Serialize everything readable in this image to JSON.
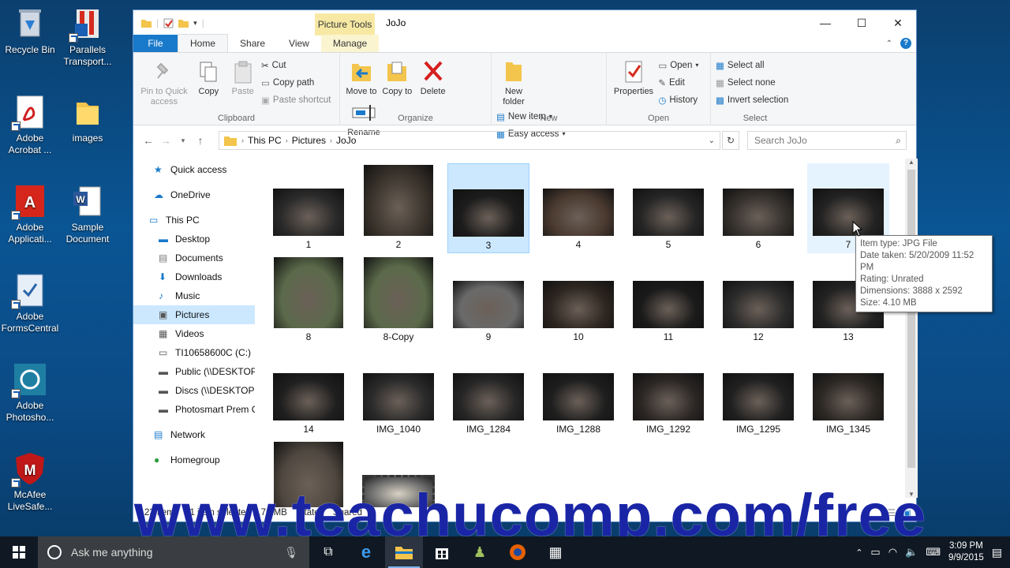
{
  "desktop": {
    "icons": [
      {
        "label": "Recycle Bin",
        "icon": "recycle-bin-icon"
      },
      {
        "label": "Parallels Transport...",
        "icon": "parallels-icon"
      },
      {
        "label": "Adobe Acrobat ...",
        "icon": "acrobat-icon"
      },
      {
        "label": "images",
        "icon": "folder-icon"
      },
      {
        "label": "Adobe Applicati...",
        "icon": "adobe-app-icon"
      },
      {
        "label": "Sample Document",
        "icon": "word-document-icon"
      },
      {
        "label": "Adobe FormsCentral",
        "icon": "formscentral-icon"
      },
      {
        "label": "Adobe Photosho...",
        "icon": "photoshop-icon"
      },
      {
        "label": "McAfee LiveSafe...",
        "icon": "mcafee-icon"
      }
    ]
  },
  "window": {
    "title": "JoJo",
    "context_tab": "Picture Tools",
    "tabs": [
      "File",
      "Home",
      "Share",
      "View",
      "Manage"
    ],
    "controls": {
      "minimize": "—",
      "maximize": "☐",
      "close": "✕"
    }
  },
  "ribbon": {
    "clipboard": {
      "label": "Clipboard",
      "pin": "Pin to Quick access",
      "copy": "Copy",
      "paste": "Paste",
      "cut": "Cut",
      "copy_path": "Copy path",
      "paste_shortcut": "Paste shortcut"
    },
    "organize": {
      "label": "Organize",
      "move_to": "Move to",
      "copy_to": "Copy to",
      "delete": "Delete",
      "rename": "Rename"
    },
    "new": {
      "label": "New",
      "new_folder": "New folder",
      "new_item": "New item",
      "easy_access": "Easy access"
    },
    "open": {
      "label": "Open",
      "properties": "Properties",
      "open": "Open",
      "edit": "Edit",
      "history": "History"
    },
    "select": {
      "label": "Select",
      "select_all": "Select all",
      "select_none": "Select none",
      "invert": "Invert selection"
    }
  },
  "address": {
    "crumbs": [
      "This PC",
      "Pictures",
      "JoJo"
    ],
    "search_placeholder": "Search JoJo"
  },
  "nav": [
    {
      "label": "Quick access",
      "icon": "star-icon"
    },
    {
      "label": "OneDrive",
      "icon": "cloud-icon"
    },
    {
      "label": "This PC",
      "icon": "computer-icon"
    },
    {
      "label": "Desktop",
      "icon": "desktop-icon"
    },
    {
      "label": "Documents",
      "icon": "documents-icon"
    },
    {
      "label": "Downloads",
      "icon": "download-icon"
    },
    {
      "label": "Music",
      "icon": "music-icon"
    },
    {
      "label": "Pictures",
      "icon": "pictures-icon"
    },
    {
      "label": "Videos",
      "icon": "videos-icon"
    },
    {
      "label": "TI10658600C (C:)",
      "icon": "drive-icon"
    },
    {
      "label": "Public (\\\\DESKTOP",
      "icon": "network-drive-icon"
    },
    {
      "label": "Discs (\\\\DESKTOP-I",
      "icon": "network-drive-icon"
    },
    {
      "label": "Photosmart Prem C",
      "icon": "network-drive-icon"
    },
    {
      "label": "Network",
      "icon": "network-icon"
    },
    {
      "label": "Homegroup",
      "icon": "homegroup-icon"
    }
  ],
  "files": [
    "1",
    "2",
    "3",
    "4",
    "5",
    "6",
    "7",
    "8",
    "8-Copy",
    "9",
    "10",
    "11",
    "12",
    "13",
    "14",
    "IMG_1040",
    "IMG_1284",
    "IMG_1288",
    "IMG_1292",
    "IMG_1295",
    "IMG_1345",
    "",
    ""
  ],
  "tooltip": {
    "type": "Item type: JPG File",
    "date": "Date taken: 5/20/2009 11:52 PM",
    "rating": "Rating: Unrated",
    "dimensions": "Dimensions: 3888 x 2592",
    "size": "Size: 4.10 MB"
  },
  "status": {
    "items": "23 items",
    "selected": "1 item selected  3.76 MB",
    "state": "State:",
    "shared": "Shared"
  },
  "watermark": "www.teachucomp.com/free",
  "taskbar": {
    "search": "Ask me anything",
    "time": "3:09 PM",
    "date": "9/9/2015"
  },
  "colors": {
    "accent": "#1979ca",
    "selection": "#cce8ff",
    "watermark": "#1a25a6"
  }
}
